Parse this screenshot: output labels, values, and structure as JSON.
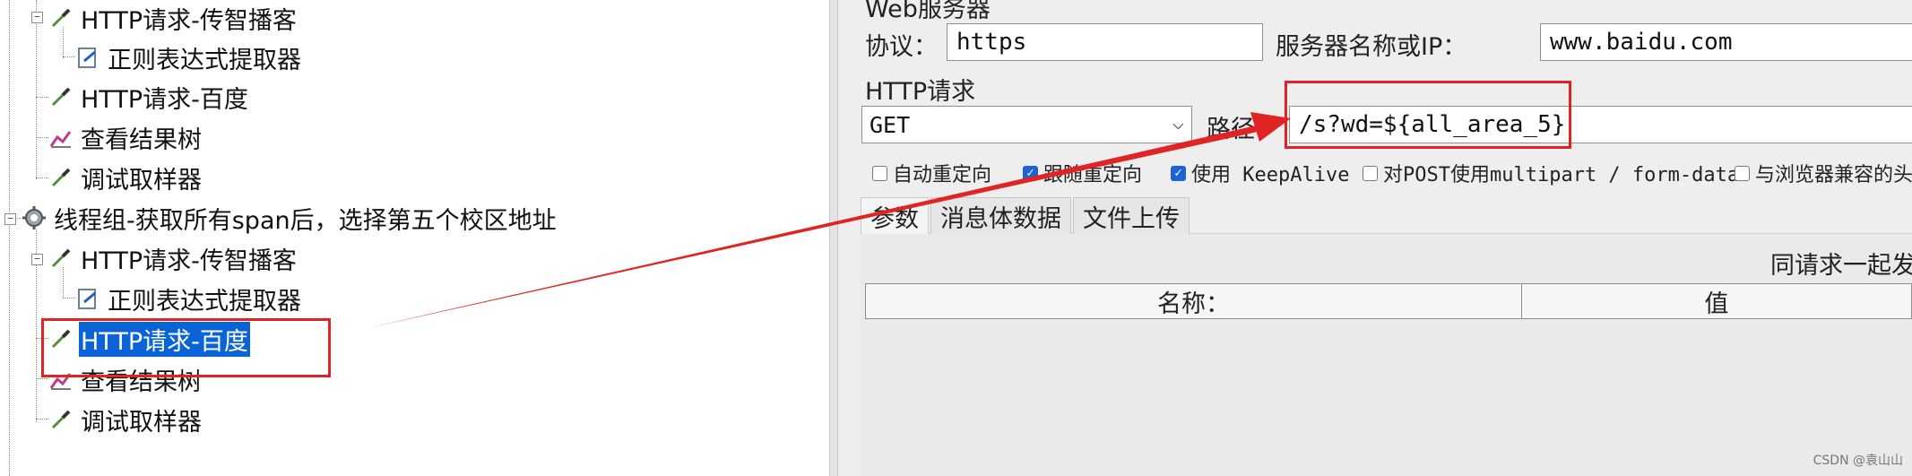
{
  "tree": {
    "items": [
      {
        "label": "HTTP请求-传智播客",
        "icon": "pipette-sampler-icon"
      },
      {
        "label": "正则表达式提取器",
        "icon": "extractor-note-icon"
      },
      {
        "label": "HTTP请求-百度",
        "icon": "pipette-sampler-icon"
      },
      {
        "label": "查看结果树",
        "icon": "result-tree-chart-icon"
      },
      {
        "label": "调试取样器",
        "icon": "pipette-sampler-icon"
      },
      {
        "label": "线程组-获取所有span后，选择第五个校区地址",
        "icon": "gear-thread-group-icon"
      },
      {
        "label": "HTTP请求-传智播客",
        "icon": "pipette-sampler-icon"
      },
      {
        "label": "正则表达式提取器",
        "icon": "extractor-note-icon"
      },
      {
        "label": "HTTP请求-百度",
        "icon": "pipette-sampler-icon",
        "selected": true
      },
      {
        "label": "查看结果树",
        "icon": "result-tree-chart-icon"
      },
      {
        "label": "调试取样器",
        "icon": "pipette-sampler-icon"
      }
    ]
  },
  "panel": {
    "web_server_title": "Web服务器",
    "protocol_label": "协议：",
    "protocol_value": "https",
    "server_label": "服务器名称或IP：",
    "server_value": "www.baidu.com",
    "http_request_title": "HTTP请求",
    "method_value": "GET",
    "path_label": "路径：",
    "path_value": "/s?wd=${all_area_5}",
    "options": [
      {
        "label": "自动重定向",
        "checked": false
      },
      {
        "label": "跟随重定向",
        "checked": true
      },
      {
        "label": "使用 KeepAlive",
        "checked": true
      },
      {
        "label": "对POST使用multipart / form-data",
        "checked": false
      },
      {
        "label": "与浏览器兼容的头",
        "checked": false
      }
    ],
    "tabs": [
      "参数",
      "消息体数据",
      "文件上传"
    ],
    "send_params_label": "同请求一起发送参数：",
    "table_headers": [
      "名称：",
      "值"
    ]
  },
  "annotation": {
    "color": "#e02424"
  },
  "watermark": "CSDN @袁山山"
}
